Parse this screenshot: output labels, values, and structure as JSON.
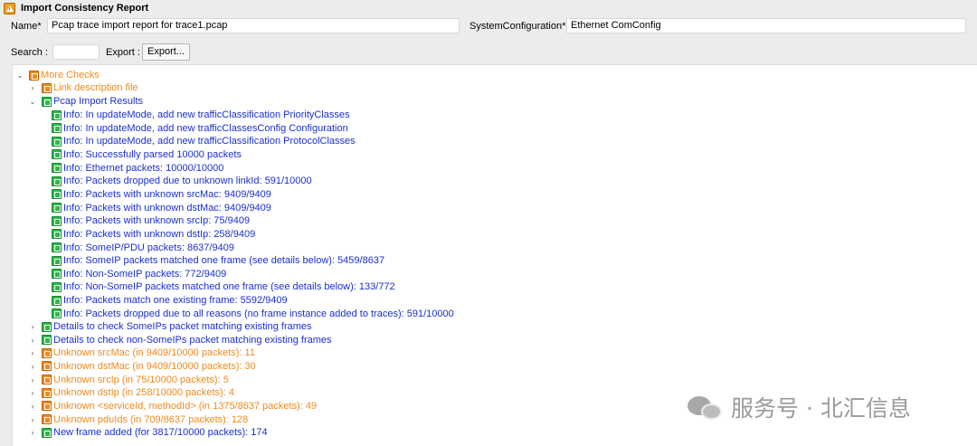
{
  "window": {
    "title": "Import Consistency Report"
  },
  "form": {
    "name_label": "Name*",
    "name_value": "Pcap trace import report for trace1.pcap",
    "sysconfig_label": "SystemConfiguration*",
    "sysconfig_value": "Ethernet ComConfig",
    "search_label": "Search :",
    "search_value": "",
    "export_label": "Export :",
    "export_button": "Export..."
  },
  "tree": {
    "root": {
      "label": "More Checks",
      "expanded": true,
      "color": "#f08a1c",
      "icon": "orange-document-icon"
    },
    "link_description": {
      "label": "Link description file",
      "expanded": false
    },
    "pcap_results": {
      "label": "Pcap Import Results",
      "expanded": true
    },
    "infos": [
      "Info: In updateMode, add new trafficClassification PriorityClasses",
      "Info: In updateMode, add new trafficClassesConfig Configuration",
      "Info: In updateMode, add new trafficClassification ProtocolClasses",
      "Info: Successfully parsed 10000 packets",
      "Info: Ethernet packets: 10000/10000",
      "Info: Packets dropped due to unknown linkId: 591/10000",
      "Info: Packets with unknown srcMac: 9409/9409",
      "Info: Packets with unknown dstMac: 9409/9409",
      "Info: Packets with unknown srcIp: 75/9409",
      "Info: Packets with unknown dstIp: 258/9409",
      "Info: SomeIP/PDU packets: 8637/9409",
      "Info: SomeIP packets matched one frame (see details below): 5459/8637",
      "Info: Non-SomeIP packets: 772/9409",
      "Info: Non-SomeIP packets matched one frame (see details below): 133/772",
      "Info: Packets match one existing frame: 5592/9409",
      "Info: Packets dropped due to all reasons (no frame instance added to traces): 591/10000"
    ],
    "groups": [
      {
        "label": "Details to check SomeIPs packet matching existing frames",
        "color": "blue"
      },
      {
        "label": "Details to check non-SomeIPs packet matching existing frames",
        "color": "blue"
      },
      {
        "label": "Unknown srcMac (in 9409/10000 packets): 11",
        "color": "orange"
      },
      {
        "label": "Unknown dstMac (in 9409/10000 packets): 30",
        "color": "orange"
      },
      {
        "label": "Unknown srcIp (in 75/10000 packets): 5",
        "color": "orange"
      },
      {
        "label": "Unknown dstIp (in 258/10000 packets): 4",
        "color": "orange"
      },
      {
        "label": "Unknown <serviceId, methodId> (in 1375/8637 packets): 49",
        "color": "orange"
      },
      {
        "label": "Unknown pduIds (in 709/8637 packets): 128",
        "color": "orange"
      },
      {
        "label": "New frame added (for 3817/10000 packets): 174",
        "color": "blue"
      }
    ]
  },
  "watermark": {
    "text": "服务号 · 北汇信息",
    "icon": "wechat-icon"
  },
  "colors": {
    "orange": "#f08a1c",
    "blue": "#1a2fd0",
    "green_icon": "#2eb84a"
  }
}
